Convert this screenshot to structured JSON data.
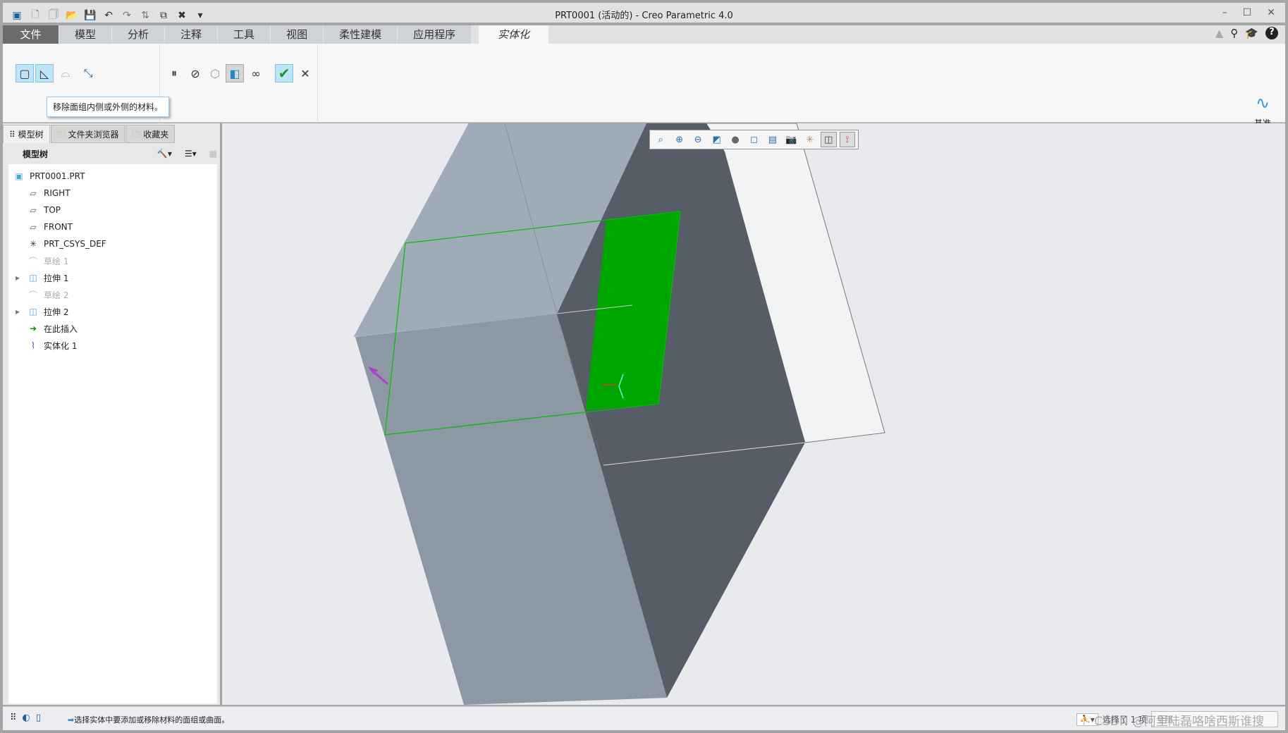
{
  "window": {
    "title": "PRT0001 (活动的) - Creo Parametric 4.0",
    "minimize": "–",
    "maximize": "☐",
    "close": "✕"
  },
  "quick_access": [
    "▣",
    "🗋",
    "🗍",
    "📂",
    "💾",
    "↶",
    "↷",
    "⇅",
    "⧉",
    "✖",
    "▾"
  ],
  "tabs": [
    "文件",
    "模型",
    "分析",
    "注释",
    "工具",
    "视图",
    "柔性建模",
    "应用程序",
    "实体化"
  ],
  "help_icons": [
    "▲",
    "⚲",
    "🎓",
    "?"
  ],
  "ribbon": {
    "tooltip": "移除面组内侧或外侧的材料。",
    "datum_label": "基准",
    "datum_more": "▾"
  },
  "panel": {
    "tabs": [
      "模型树",
      "文件夹浏览器",
      "收藏夹"
    ],
    "header": "模型树"
  },
  "tree": [
    {
      "label": "PRT0001.PRT",
      "icon": "part-icon"
    },
    {
      "label": "RIGHT",
      "icon": "datum-plane-icon"
    },
    {
      "label": "TOP",
      "icon": "datum-plane-icon"
    },
    {
      "label": "FRONT",
      "icon": "datum-plane-icon"
    },
    {
      "label": "PRT_CSYS_DEF",
      "icon": "csys-icon"
    },
    {
      "label": "草绘 1",
      "icon": "sketch-icon",
      "dim": true
    },
    {
      "label": "拉伸 1",
      "icon": "extrude-icon",
      "expand": true
    },
    {
      "label": "草绘 2",
      "icon": "sketch-icon",
      "dim": true
    },
    {
      "label": "拉伸 2",
      "icon": "extrude-icon",
      "expand": true
    },
    {
      "label": "在此插入",
      "icon": "insert-here-icon"
    },
    {
      "label": "实体化 1",
      "icon": "solidify-icon"
    }
  ],
  "status": {
    "message": "选择实体中要添加或移除材料的面组或曲面。",
    "selected": "选择了 1 项",
    "filter": "全部",
    "watermark": "CSDN @阿里陆磊咯啥西斯谁搜"
  },
  "colors": {
    "green_surface": "#00a600",
    "dark_face": "#575d66",
    "mid_face": "#8d98a5",
    "light_face": "#a0abb9",
    "arrow": "#b040d0"
  }
}
